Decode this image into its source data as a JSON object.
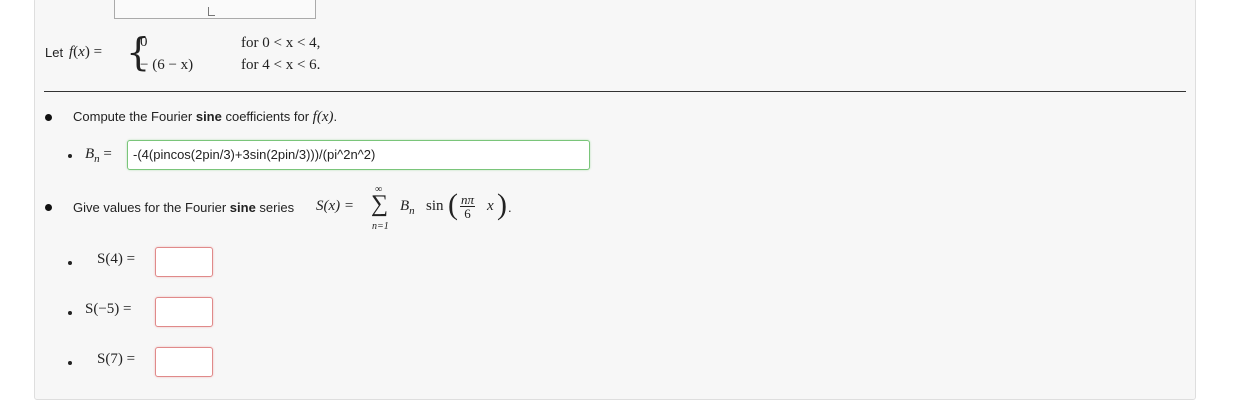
{
  "definition": {
    "prefix": "Let",
    "fname": "f",
    "var": "x",
    "case1_value": "0",
    "case1_cond": "for  0 < x < 4,",
    "case2_value": "− (6 − x)",
    "case2_cond": "for  4 < x < 6."
  },
  "part1": {
    "text_before": "Compute the Fourier ",
    "bold": "sine",
    "text_after": " coefficients for ",
    "func": "f(x)",
    "end": ".",
    "bn_label": "B",
    "bn_sub": "n",
    "equals": "=",
    "bn_value": "-(4(pincos(2pin/3)+3sin(2pin/3)))/(pi^2n^2)"
  },
  "part2": {
    "text_before": "Give values for the Fourier ",
    "bold": "sine",
    "text_after": " series ",
    "series_lhs": "S(x) =",
    "sum_top": "∞",
    "sum_symbol": "∑",
    "sum_bottom": "n=1",
    "term": "B",
    "term_sub": "n",
    "sin": "sin",
    "frac_num": "nπ",
    "frac_den": "6",
    "var": "x",
    "end": "."
  },
  "evaluations": [
    {
      "label": "S(4) =",
      "value": ""
    },
    {
      "label": "S(−5) =",
      "value": ""
    },
    {
      "label": "S(7) =",
      "value": ""
    }
  ]
}
